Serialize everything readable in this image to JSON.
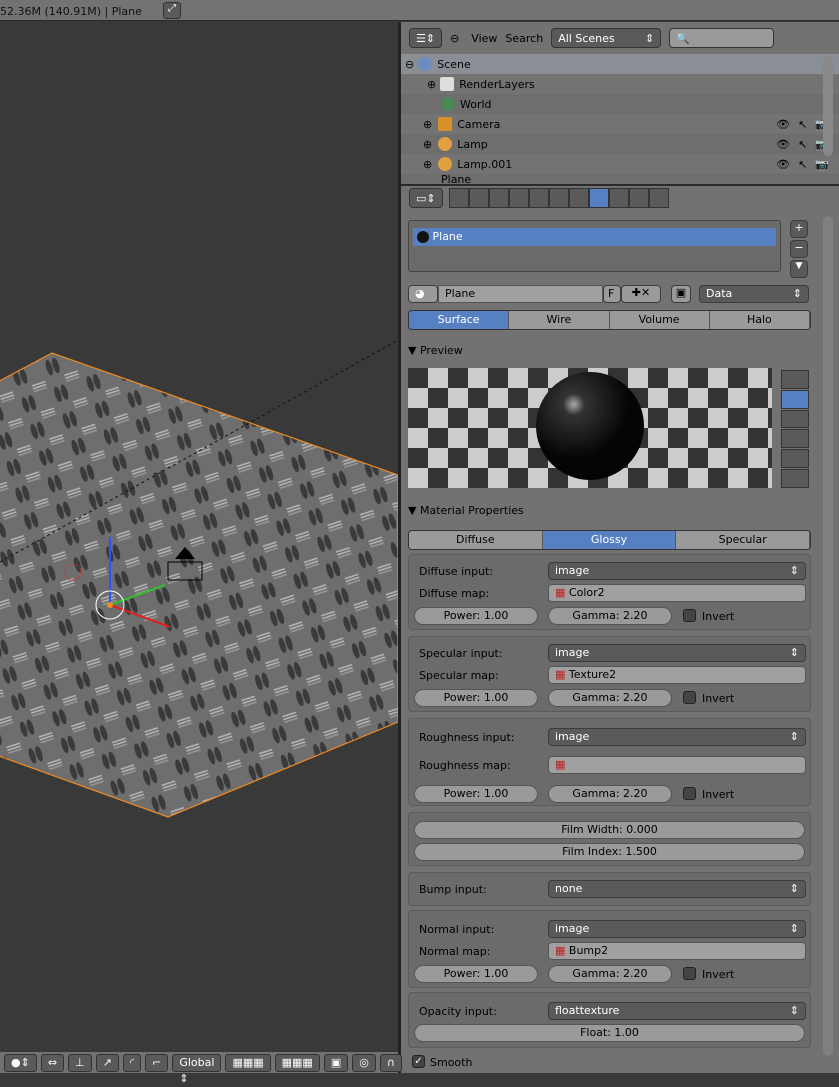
{
  "topbar": {
    "stats": "52.36M (140.91M) | Plane"
  },
  "outliner": {
    "view": "View",
    "search": "Search",
    "scene_select": "All Scenes",
    "search_placeholder": "",
    "items": [
      {
        "label": "Scene"
      },
      {
        "label": "RenderLayers"
      },
      {
        "label": "World"
      },
      {
        "label": "Camera"
      },
      {
        "label": "Lamp"
      },
      {
        "label": "Lamp.001"
      },
      {
        "label": "Plane"
      }
    ]
  },
  "properties": {
    "tabs": [
      "render",
      "scene",
      "world",
      "object",
      "constraints",
      "modifiers",
      "data",
      "material",
      "texture",
      "particles",
      "physics"
    ],
    "active_tab": "material",
    "slot_list": [
      "Plane"
    ],
    "material_name": "Plane",
    "fake_user": "F",
    "link": "Data",
    "type_tabs": [
      "Surface",
      "Wire",
      "Volume",
      "Halo"
    ],
    "active_type": "Surface",
    "preview_title": "Preview",
    "matprops_title": "Material Properties",
    "shader_tabs": [
      "Diffuse",
      "Glossy",
      "Specular"
    ],
    "active_shader": "Glossy",
    "diffuse": {
      "input_label": "Diffuse input:",
      "input": "image",
      "map_label": "Diffuse map:",
      "map": "Color2",
      "power": "Power: 1.00",
      "gamma": "Gamma: 2.20",
      "invert": "Invert"
    },
    "specular": {
      "input_label": "Specular input:",
      "input": "image",
      "map_label": "Specular map:",
      "map": "Texture2",
      "power": "Power: 1.00",
      "gamma": "Gamma: 2.20",
      "invert": "Invert"
    },
    "roughness": {
      "input_label": "Roughness input:",
      "input": "image",
      "map_label": "Roughness map:",
      "map": "",
      "power": "Power: 1.00",
      "gamma": "Gamma: 2.20",
      "invert": "Invert"
    },
    "film": {
      "width": "Film Width: 0.000",
      "index": "Film Index: 1.500"
    },
    "bump": {
      "input_label": "Bump input:",
      "input": "none"
    },
    "normal": {
      "input_label": "Normal input:",
      "input": "image",
      "map_label": "Normal map:",
      "map": "Bump2",
      "power": "Power: 1.00",
      "gamma": "Gamma: 2.20",
      "invert": "Invert"
    },
    "opacity": {
      "input_label": "Opacity input:",
      "input": "floattexture",
      "float": "Float: 1.00"
    },
    "smooth": "Smooth"
  },
  "statusbar": {
    "orientation": "Global"
  },
  "colors": {
    "accent": "#5680c2",
    "selection": "#f08a24"
  }
}
